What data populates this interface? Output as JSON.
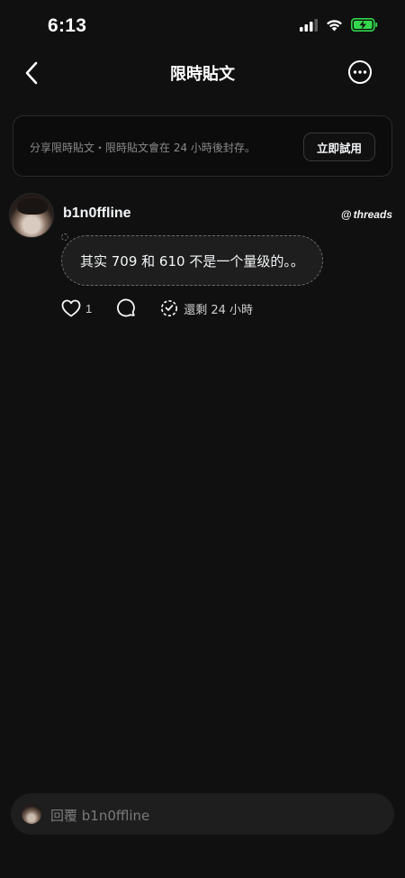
{
  "status_bar": {
    "time": "6:13",
    "battery_color": "#32d74b"
  },
  "nav": {
    "title": "限時貼文"
  },
  "banner": {
    "text": "分享限時貼文・限時貼文會在 24 小時後封存。",
    "button_label": "立即試用"
  },
  "post": {
    "username": "b1n0ffline",
    "brand_symbol": "@",
    "brand_word": "threads",
    "text": "其实 709 和 610 不是一个量级的。。",
    "like_count": "1",
    "expire_text": "還剩 24 小時"
  },
  "reply": {
    "placeholder": "回覆 b1n0ffline"
  },
  "icons": [
    "chevron-left-icon",
    "more-icon",
    "heart-icon",
    "comment-icon",
    "expire-icon",
    "signal-icon",
    "wifi-icon",
    "battery-icon"
  ]
}
